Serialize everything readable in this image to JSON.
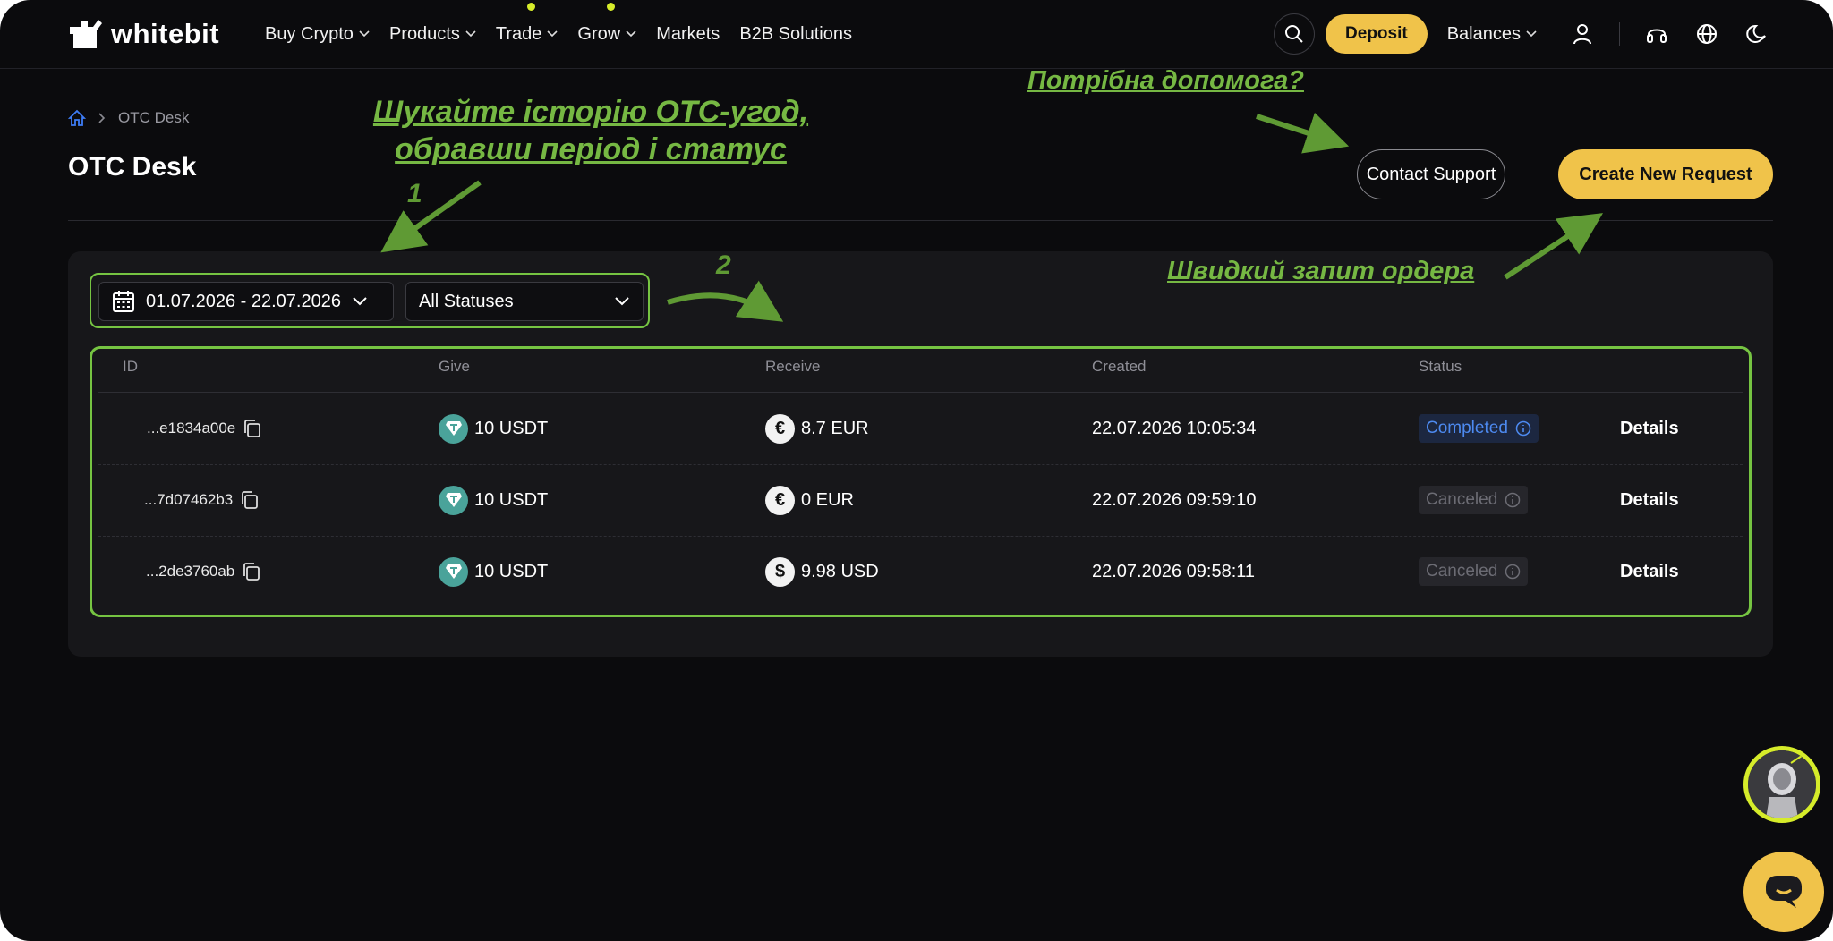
{
  "nav": {
    "logo_text": "whitebit",
    "items": [
      {
        "label": "Buy Crypto",
        "dropdown": true,
        "dot": false
      },
      {
        "label": "Products",
        "dropdown": true,
        "dot": false
      },
      {
        "label": "Trade",
        "dropdown": true,
        "dot": true
      },
      {
        "label": "Grow",
        "dropdown": true,
        "dot": true
      },
      {
        "label": "Markets",
        "dropdown": false,
        "dot": false
      },
      {
        "label": "B2B Solutions",
        "dropdown": false,
        "dot": false
      }
    ],
    "deposit_label": "Deposit",
    "balances_label": "Balances"
  },
  "breadcrumb": {
    "current": "OTC Desk"
  },
  "page": {
    "title": "OTC Desk",
    "contact_label": "Contact Support",
    "create_label": "Create New Request"
  },
  "filters": {
    "date_range": "01.07.2026 - 22.07.2026",
    "status": "All Statuses"
  },
  "table": {
    "headers": {
      "id": "ID",
      "give": "Give",
      "receive": "Receive",
      "created": "Created",
      "status": "Status"
    },
    "rows": [
      {
        "id": "...e1834a00e",
        "give": "10 USDT",
        "receive": "8.7 EUR",
        "receive_symbol": "€",
        "created": "22.07.2026 10:05:34",
        "status": "Completed",
        "details": "Details"
      },
      {
        "id": "...7d07462b3",
        "give": "10 USDT",
        "receive": "0 EUR",
        "receive_symbol": "€",
        "created": "22.07.2026 09:59:10",
        "status": "Canceled",
        "details": "Details"
      },
      {
        "id": "...2de3760ab",
        "give": "10 USDT",
        "receive": "9.98 USD",
        "receive_symbol": "$",
        "created": "22.07.2026 09:58:11",
        "status": "Canceled",
        "details": "Details"
      }
    ]
  },
  "annotations": {
    "history_line1": "Шукайте історію ОТС-угод,",
    "history_line2": "обравши період і статус",
    "help": "Потрібна допомога?",
    "quick_order": "Швидкий запит ордера",
    "num1": "1",
    "num2": "2"
  },
  "colors": {
    "accent": "#f0c34a",
    "annotation": "#76b843",
    "completed": "#4d8af0",
    "canceled": "#6c6c74"
  }
}
